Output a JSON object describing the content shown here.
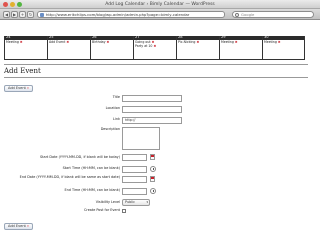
{
  "browser": {
    "window_title": "Add Log Calendar › Bimly Calendar — WordPress",
    "url": "http://www.erikchlips.com/blog/wp-admin/admin.php?page=bimly-calendar",
    "search_placeholder": "Google"
  },
  "calendar": {
    "days": [
      {
        "num": "24",
        "events": [
          {
            "text": "Meeting"
          }
        ]
      },
      {
        "num": "25",
        "events": [
          {
            "text": "Add Event"
          }
        ]
      },
      {
        "num": "26",
        "events": [
          {
            "text": "Birthday"
          }
        ]
      },
      {
        "num": "27",
        "events": [
          {
            "text": "Going out"
          },
          {
            "text": "Party at 10"
          }
        ]
      },
      {
        "num": "28",
        "events": [
          {
            "text": "Pic-Nicking"
          }
        ]
      },
      {
        "num": "29",
        "events": [
          {
            "text": "Meeting"
          }
        ]
      },
      {
        "num": "30",
        "events": [
          {
            "text": "Meeting"
          }
        ]
      }
    ],
    "remove_mark": "✖"
  },
  "page": {
    "title": "Add Event",
    "top_button": "Add Event",
    "bottom_button": "Add Event"
  },
  "form": {
    "title_label": "Title",
    "location_label": "Location",
    "link_label": "Link",
    "link_value": "http://",
    "description_label": "Description",
    "start_date_label": "Start Date (YYYY-MM-DD, if blank will be today)",
    "start_time_label": "Start Time (HH:MM, can be blank)",
    "end_date_label": "End Date (YYYY-MM-DD, if blank will be same as start date)",
    "end_time_label": "End Time (HH:MM, can be blank)",
    "visibility_label": "Visibility Level",
    "visibility_value": "Public",
    "create_post_label": "Create Post for Event"
  }
}
